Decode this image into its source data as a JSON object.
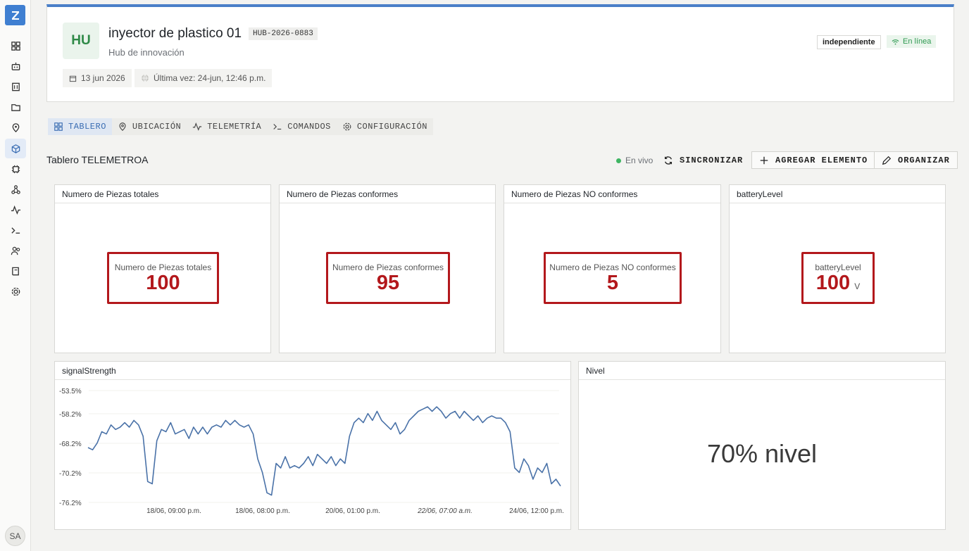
{
  "sidebar": {
    "user_initials": "SA",
    "items": [
      {
        "icon": "dashboard-icon"
      },
      {
        "icon": "robot-icon"
      },
      {
        "icon": "building-icon"
      },
      {
        "icon": "folder-icon"
      },
      {
        "icon": "location-pin-icon"
      },
      {
        "icon": "cube-icon",
        "active": true
      },
      {
        "icon": "chip-icon"
      },
      {
        "icon": "network-icon"
      },
      {
        "icon": "activity-icon"
      },
      {
        "icon": "terminal-icon"
      },
      {
        "icon": "users-icon"
      },
      {
        "icon": "book-icon"
      },
      {
        "icon": "settings-icon"
      }
    ]
  },
  "device": {
    "avatar": "HU",
    "name": "inyector de plastico 01",
    "code": "HUB-2026-0883",
    "subtitle": "Hub de innovación",
    "created": "13 jun 2026",
    "last_seen": "Última vez: 24-jun, 12:46 p.m.",
    "badge_type": "independiente",
    "badge_status": "En línea"
  },
  "tabs": [
    {
      "label": "TABLERO",
      "icon": "grid-icon",
      "active": true
    },
    {
      "label": "UBICACIÓN",
      "icon": "location-pin-icon"
    },
    {
      "label": "TELEMETRÍA",
      "icon": "activity-icon"
    },
    {
      "label": "COMANDOS",
      "icon": "terminal-icon"
    },
    {
      "label": "CONFIGURACIÓN",
      "icon": "gear-icon"
    }
  ],
  "toolbar": {
    "title": "Tablero TELEMETROA",
    "live": "En vivo",
    "sync": "SINCRONIZAR",
    "add": "AGREGAR ELEMENTO",
    "organize": "ORGANIZAR"
  },
  "widgets": {
    "total": {
      "title": "Numero de Piezas totales",
      "label": "Numero de Piezas totales",
      "value": "100"
    },
    "conformes": {
      "title": "Numero de Piezas conformes",
      "label": "Numero de Piezas conformes",
      "value": "95"
    },
    "no_conformes": {
      "title": "Numero de Piezas NO conformes",
      "label": "Numero de Piezas NO conformes",
      "value": "5"
    },
    "battery": {
      "title": "batteryLevel",
      "label": "batteryLevel",
      "value": "100",
      "unit": "V"
    },
    "signal": {
      "title": "signalStrength"
    },
    "nivel": {
      "title": "Nivel",
      "text": "70% nivel"
    }
  },
  "chart_data": {
    "type": "line",
    "title": "signalStrength",
    "y_ticks": [
      "-53.5%",
      "-58.2%",
      "-68.2%",
      "-70.2%",
      "-76.2%"
    ],
    "x_ticks": [
      "18/06, 09:00 p.m.",
      "18/06, 08:00 p.m.",
      "20/06, 01:00 p.m.",
      "22/06, 07:00 a.m.",
      "24/06, 12:00 p.m."
    ],
    "series": [
      {
        "color": "#4a72a8",
        "values": [
          -64.5,
          -65,
          -63.5,
          -61,
          -61.5,
          -59.5,
          -60.5,
          -60,
          -59,
          -60,
          -58.5,
          -59.5,
          -62,
          -72,
          -72.5,
          -63,
          -60.5,
          -61,
          -59,
          -61.5,
          -61,
          -60.5,
          -62.5,
          -60,
          -61.5,
          -60,
          -61.5,
          -60,
          -59.5,
          -60,
          -58.5,
          -59.5,
          -58.5,
          -59.5,
          -60,
          -59.5,
          -61.5,
          -67,
          -70,
          -74.5,
          -75,
          -68,
          -69,
          -66.5,
          -69,
          -68.5,
          -69,
          -68,
          -66.5,
          -68.5,
          -66,
          -67,
          -68,
          -66.5,
          -68.5,
          -67,
          -68,
          -62,
          -59,
          -58,
          -59,
          -57,
          -58.5,
          -56.5,
          -58.5,
          -59.5,
          -60.5,
          -59,
          -61.5,
          -60.5,
          -58.5,
          -57.5,
          -56.5,
          -56,
          -55.5,
          -56.5,
          -55.5,
          -56.5,
          -58,
          -57,
          -56.5,
          -58,
          -56.5,
          -57.5,
          -58.5,
          -57.5,
          -59,
          -58,
          -57.5,
          -58,
          -58,
          -59,
          -61,
          -69,
          -70,
          -67,
          -68.5,
          -71.5,
          -69,
          -70,
          -68,
          -72.5,
          -71.5,
          -73
        ]
      }
    ]
  }
}
